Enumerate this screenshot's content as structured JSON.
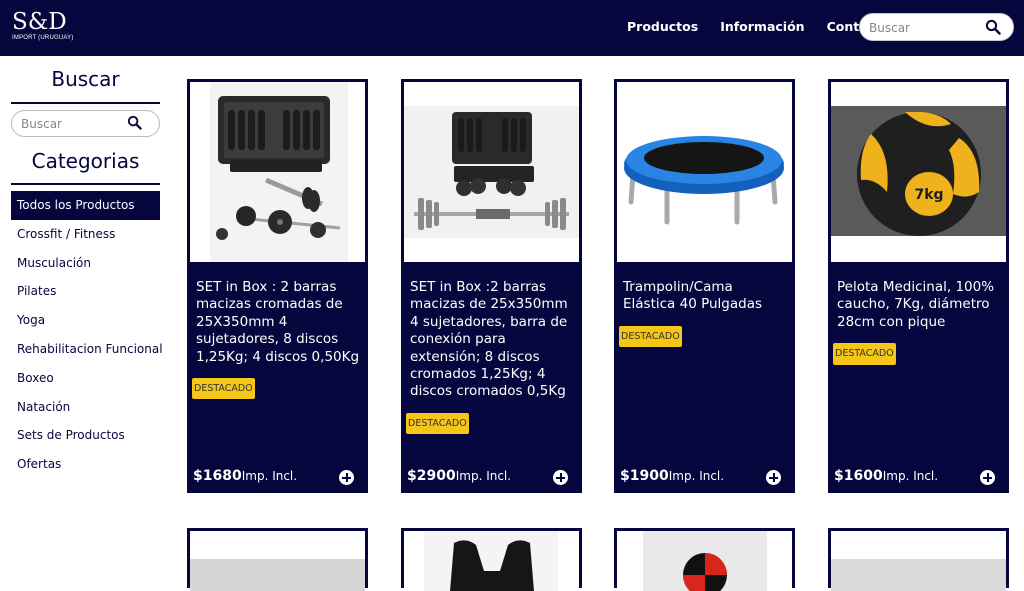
{
  "header": {
    "logo_main": "S&D",
    "logo_sub": "IMPORT (URUGUAY)",
    "nav": [
      "Productos",
      "Información",
      "Contacto"
    ],
    "search_placeholder": "Buscar"
  },
  "sidebar": {
    "search_title": "Buscar",
    "search_placeholder": "Buscar",
    "categories_title": "Categorias",
    "categories": [
      "Todos los Productos",
      "Crossfit / Fitness",
      "Musculación",
      "Pilates",
      "Yoga",
      "Rehabilitacion Funcional",
      "Boxeo",
      "Natación",
      "Sets de Productos",
      "Ofertas"
    ]
  },
  "products": [
    {
      "name": "SET in Box : 2 barras macizas cromadas de 25X350mm 4 sujetadores, 8 discos 1,25Kg; 4 discos 0,50Kg",
      "badge": "DESTACADO",
      "price": "$1680",
      "price_suffix": "Imp. Incl.",
      "image": "dumbbell-case-photo"
    },
    {
      "name": "SET in Box :2 barras macizas de 25x350mm 4 sujetadores, barra de conexión para extensión; 8 discos cromados 1,25Kg; 4 discos cromados 0,5Kg",
      "badge": "DESTACADO",
      "price": "$2900",
      "price_suffix": "Imp. Incl.",
      "image": "dumbbell-set-with-bar-photo"
    },
    {
      "name": "Trampolin/Cama Elástica 40 Pulgadas",
      "badge": "DESTACADO",
      "price": "$1900",
      "price_suffix": "Imp. Incl.",
      "image": "trampoline-photo"
    },
    {
      "name": "Pelota Medicinal, 100% caucho, 7Kg, diámetro 28cm con pique",
      "badge": "DESTACADO",
      "price": "$1600",
      "price_suffix": "Imp. Incl.",
      "image": "medicine-ball-photo",
      "image_text": "7kg"
    }
  ],
  "colors": {
    "navy": "#06063f",
    "badge": "#f5c518",
    "white": "#ffffff"
  }
}
